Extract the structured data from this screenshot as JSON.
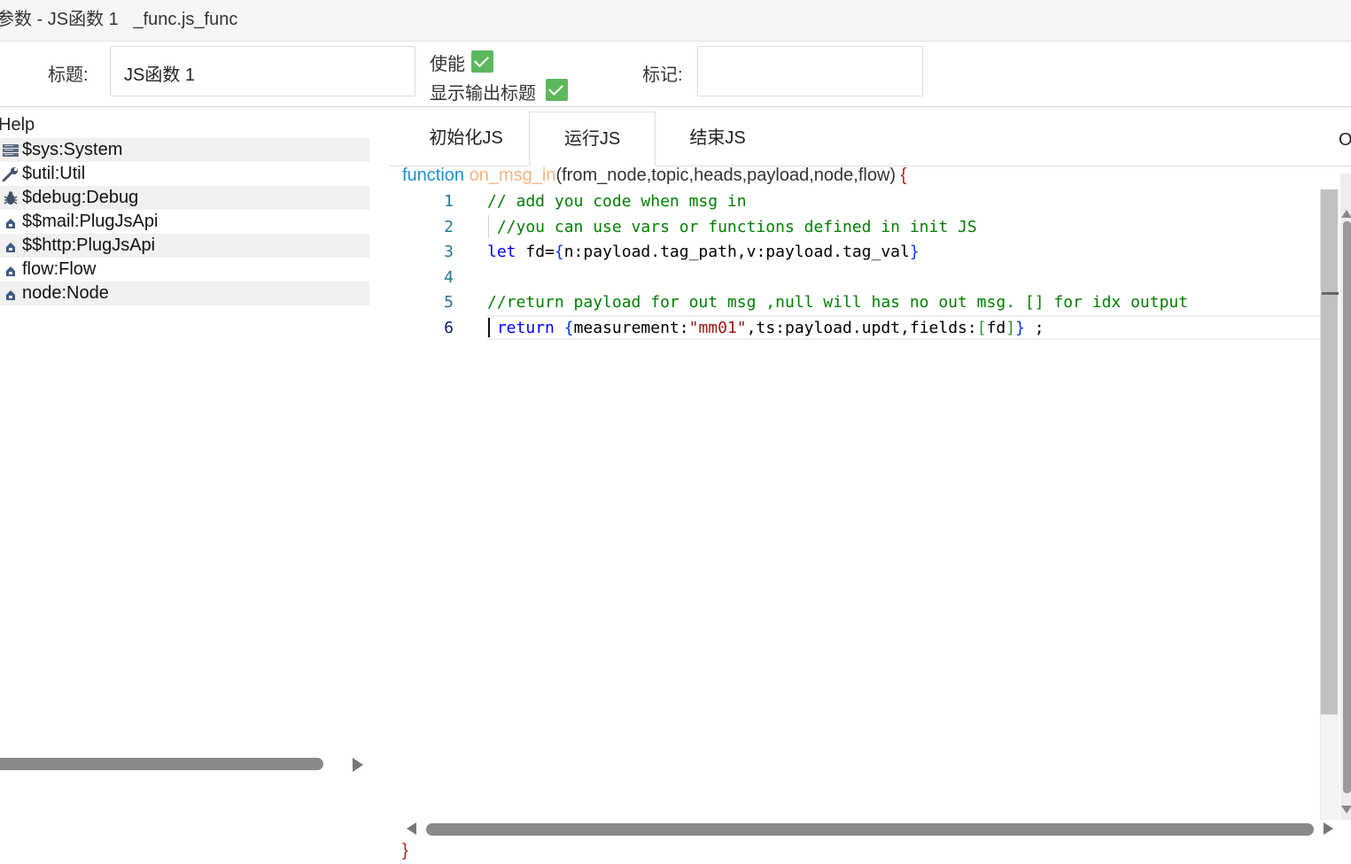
{
  "window": {
    "title": "参数 - JS函数 1   _func.js_func"
  },
  "form": {
    "title_label": "标题:",
    "title_value": "JS函数 1",
    "enable_label": "使能",
    "enable_checked": true,
    "show_output_title_label": "显示输出标题",
    "show_output_title_checked": true,
    "mark_label": "标记:",
    "mark_value": ""
  },
  "help": {
    "title": "Help",
    "items": [
      {
        "label": "$sys:System",
        "icon": "server-icon"
      },
      {
        "label": "$util:Util",
        "icon": "wrench-icon"
      },
      {
        "label": "$debug:Debug",
        "icon": "bug-icon"
      },
      {
        "label": "$$mail:PlugJsApi",
        "icon": "plugin-icon"
      },
      {
        "label": "$$http:PlugJsApi",
        "icon": "plugin-icon"
      },
      {
        "label": "flow:Flow",
        "icon": "plugin-icon"
      },
      {
        "label": "node:Node",
        "icon": "plugin-icon"
      }
    ]
  },
  "tabs": [
    {
      "label": "初始化JS",
      "active": false
    },
    {
      "label": "运行JS",
      "active": true
    },
    {
      "label": "结束JS",
      "active": false
    }
  ],
  "tab_overflow": "O",
  "editor": {
    "signature_keyword": "function",
    "signature_name": "on_msg_in",
    "signature_args": "(from_node,topic,heads,payload,node,flow)",
    "signature_open": "{",
    "closing_brace": "}",
    "line_numbers": [
      "1",
      "2",
      "3",
      "4",
      "5",
      "6"
    ],
    "lines": [
      "// add you code when msg in",
      " //you can use vars or functions defined in init JS",
      "let fd={n:payload.tag_path,v:payload.tag_val}",
      "",
      "//return payload for out msg ,null will has no out msg. [] for idx output",
      " return {measurement:\"mm01\",ts:payload.updt,fields:[fd]} ;"
    ]
  },
  "colors": {
    "accent_check": "#5cb85c",
    "function_keyword": "#1b8fd6",
    "function_name": "#f4b483",
    "comment": "#008000",
    "keyword": "#0000ff",
    "string": "#a31515",
    "line_number": "#237893"
  }
}
